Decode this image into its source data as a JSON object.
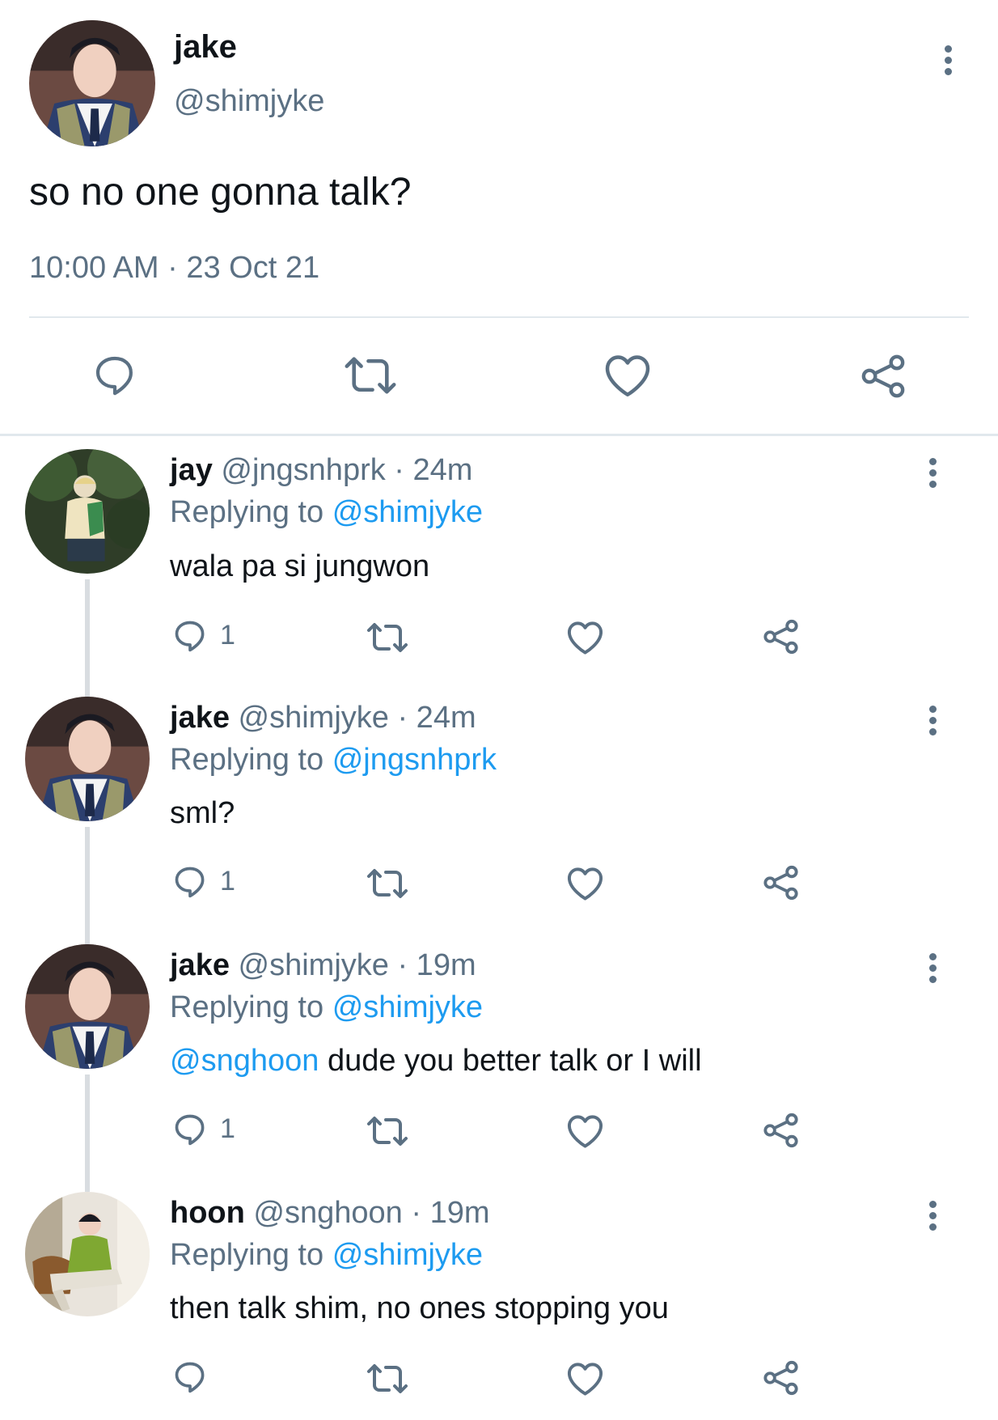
{
  "main_tweet": {
    "display_name": "jake",
    "handle": "@shimjyke",
    "text": "so no one gonna talk?",
    "timestamp": "10:00 AM · 23 Oct 21"
  },
  "replies": [
    {
      "display_name": "jay",
      "meta": "@jngsnhprk · 24m",
      "replying_prefix": "Replying to",
      "replying_to": "@shimjyke",
      "text": "wala pa si jungwon",
      "reply_count": "1"
    },
    {
      "display_name": "jake",
      "meta": "@shimjyke · 24m",
      "replying_prefix": "Replying to",
      "replying_to": "@jngsnhprk",
      "text": "sml?",
      "reply_count": "1"
    },
    {
      "display_name": "jake",
      "meta": "@shimjyke · 19m",
      "replying_prefix": "Replying to",
      "replying_to": "@shimjyke",
      "mention": "@snghoon",
      "text": "dude you better talk or I will",
      "reply_count": "1"
    },
    {
      "display_name": "hoon",
      "meta": "@snghoon · 19m",
      "replying_prefix": "Replying to",
      "replying_to": "@shimjyke",
      "text": "then talk shim, no ones stopping you",
      "reply_count": ""
    }
  ],
  "icons": {
    "reply": "reply-icon",
    "retweet": "retweet-icon",
    "like": "heart-icon",
    "share": "share-icon",
    "more": "more-options-icon"
  },
  "colors": {
    "link": "#1d9bf0",
    "muted": "#5b7083",
    "divider": "#e1e8ed",
    "thread_line": "#d9dde1"
  }
}
